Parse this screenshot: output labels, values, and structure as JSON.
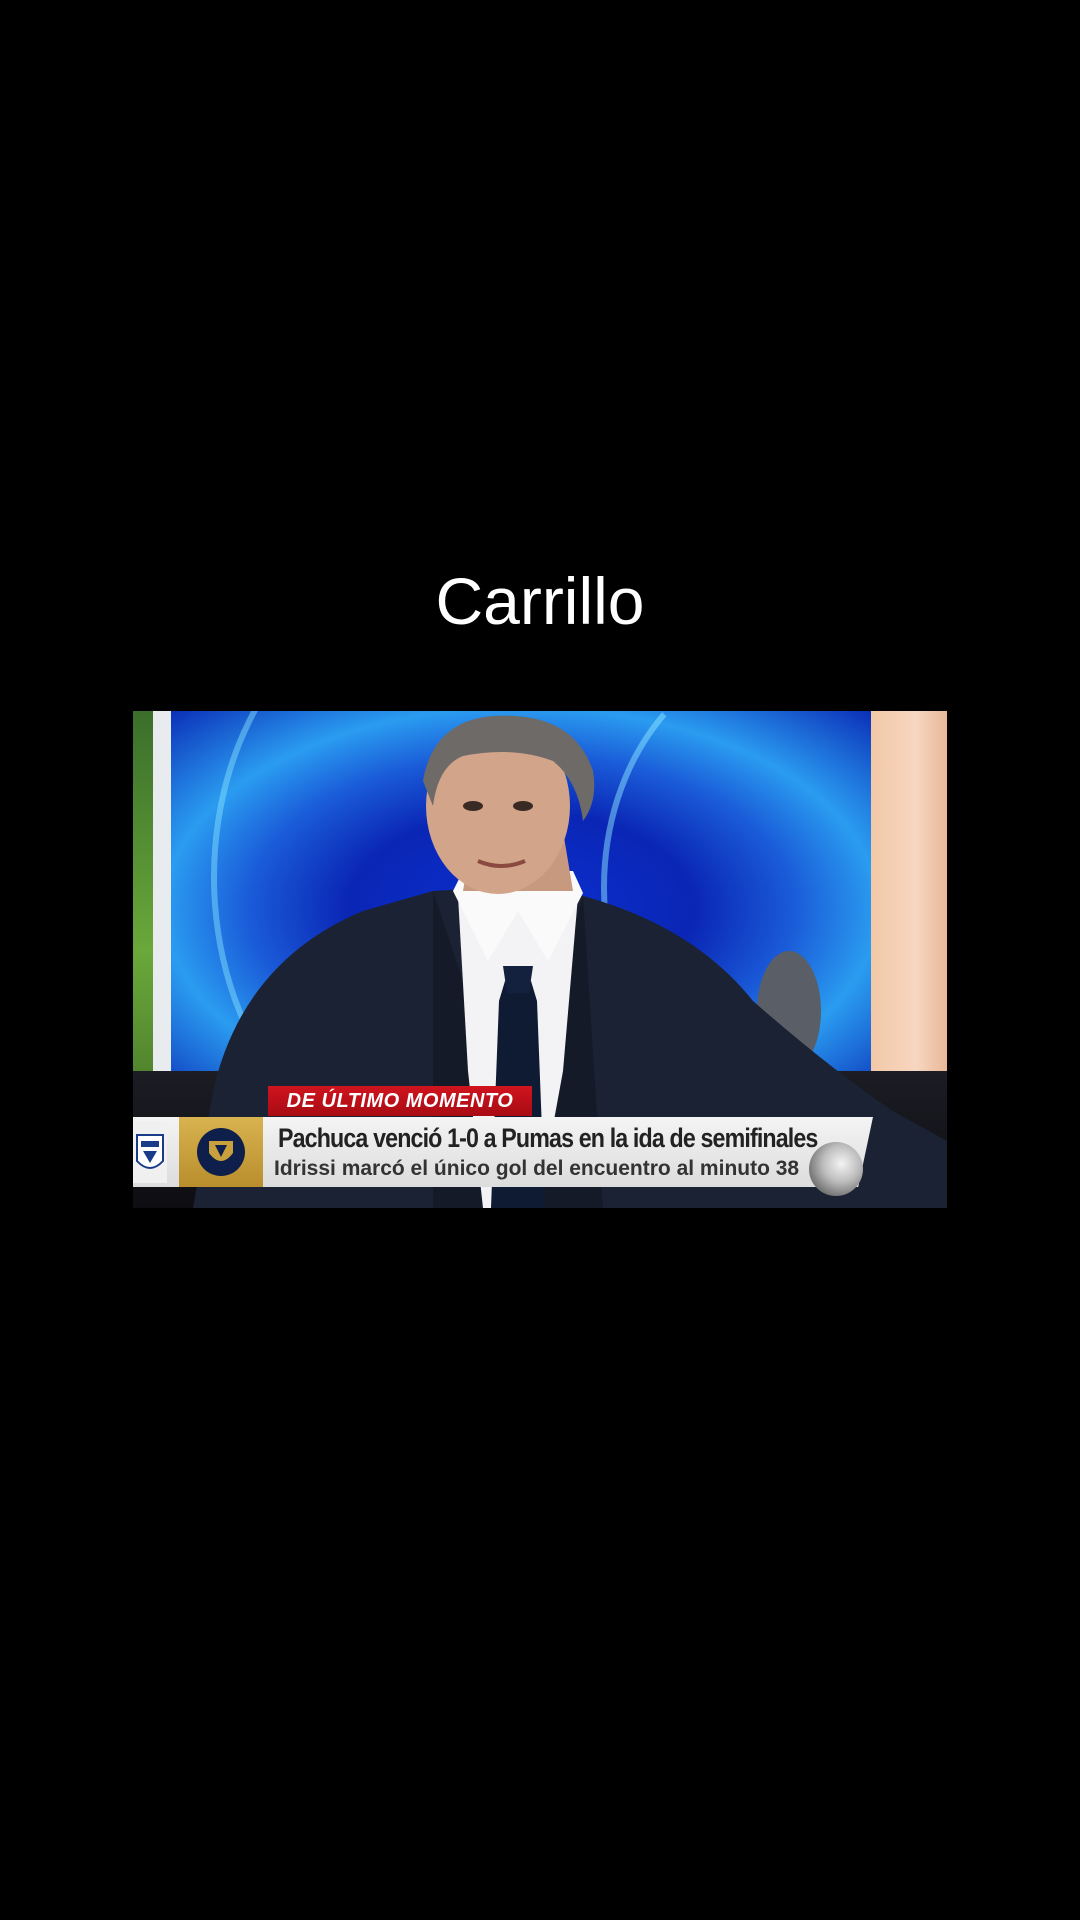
{
  "caption": {
    "text": "Carrillo"
  },
  "video": {
    "lower_third": {
      "tag": "DE ÚLTIMO MOMENTO",
      "headline": "Pachuca venció 1-0 a Pumas en la ida de semifinales",
      "subline": "Idrissi marcó el único gol del encuentro al minuto 38"
    },
    "colors": {
      "tag_red": "#c8101a",
      "ticker_bg": "#e8e8e8",
      "team_gold": "#c9a13c",
      "studio_blue": "#0b2fd0"
    },
    "icons": {
      "left_logo": "pachuca-crest-icon",
      "team_logo": "pumas-crest-icon",
      "ball": "soccer-ball-icon"
    }
  }
}
